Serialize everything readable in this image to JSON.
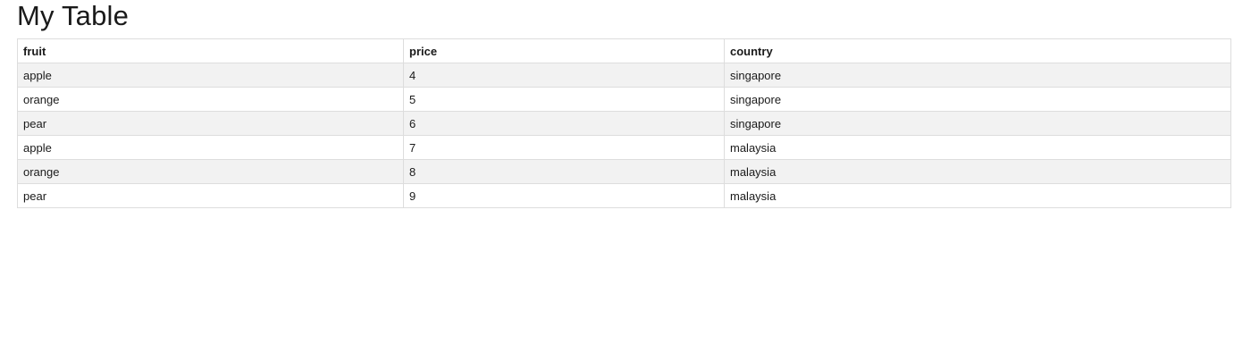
{
  "page": {
    "title": "My Table"
  },
  "table": {
    "columns": [
      "fruit",
      "price",
      "country"
    ],
    "rows": [
      [
        "apple",
        "4",
        "singapore"
      ],
      [
        "orange",
        "5",
        "singapore"
      ],
      [
        "pear",
        "6",
        "singapore"
      ],
      [
        "apple",
        "7",
        "malaysia"
      ],
      [
        "orange",
        "8",
        "malaysia"
      ],
      [
        "pear",
        "9",
        "malaysia"
      ]
    ]
  },
  "colors": {
    "border": "#dddddd",
    "stripe": "#f2f2f2",
    "text": "#1a1a1a",
    "background": "#ffffff"
  }
}
